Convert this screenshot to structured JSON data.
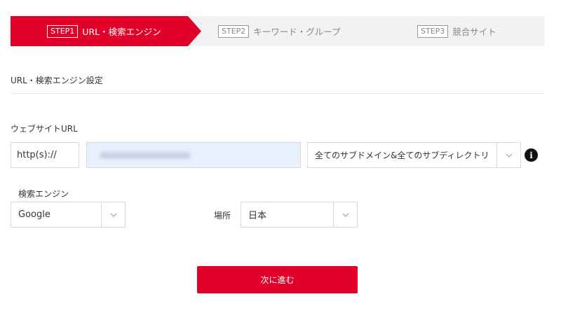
{
  "steps": [
    {
      "badge": "STEP1",
      "label": "URL・検索エンジン",
      "active": true
    },
    {
      "badge": "STEP2",
      "label": "キーワード・グループ",
      "active": false
    },
    {
      "badge": "STEP3",
      "label": "競合サイト",
      "active": false
    }
  ],
  "section_title": "URL・検索エンジン設定",
  "website_url": {
    "label": "ウェブサイトURL",
    "protocol": "http(s)://",
    "scope_selected": "全てのサブドメイン&全てのサブディレクトリ"
  },
  "search_engine": {
    "label": "検索エンジン",
    "selected": "Google"
  },
  "location": {
    "label": "場所",
    "selected": "日本"
  },
  "next_button_label": "次に進む",
  "colors": {
    "accent": "#e0002a",
    "input_fill": "#e8f0fe"
  },
  "icons": [
    "chevron-down-icon",
    "info-icon"
  ]
}
